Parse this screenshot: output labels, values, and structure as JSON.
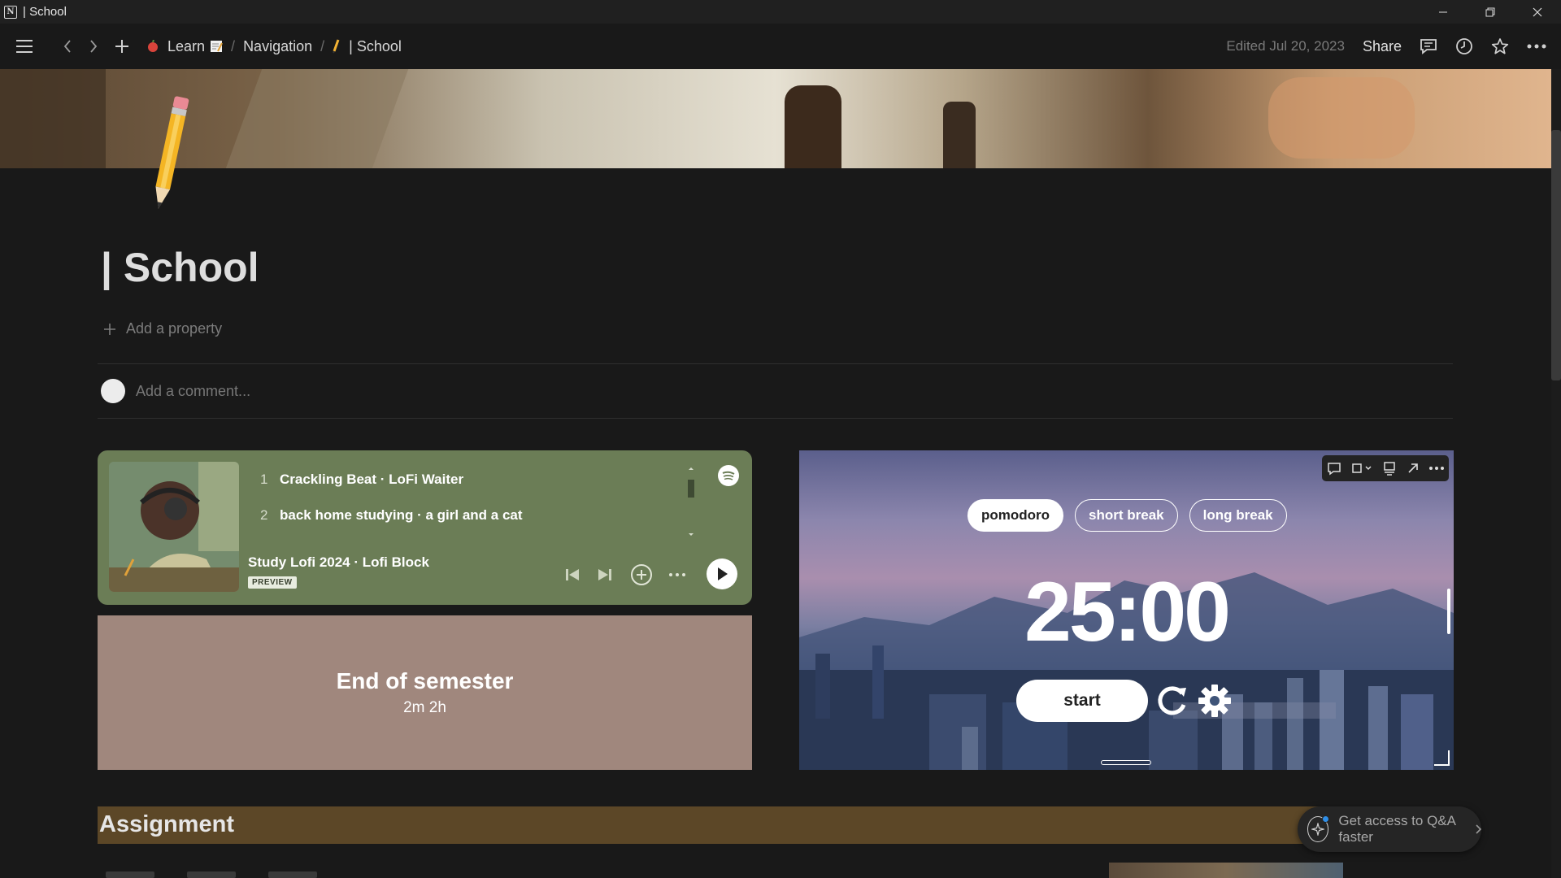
{
  "window": {
    "title": "| School"
  },
  "breadcrumb": {
    "learn": "Learn",
    "navigation": "Navigation",
    "school": "| School",
    "sep": "/"
  },
  "topbar": {
    "edited": "Edited Jul 20, 2023",
    "share": "Share"
  },
  "page": {
    "title": "| School",
    "add_property": "Add a property",
    "comment_placeholder": "Add a comment..."
  },
  "spotify": {
    "tracks": [
      {
        "num": "1",
        "title": "Crackling Beat · LoFi Waiter"
      },
      {
        "num": "2",
        "title": "back home studying · a girl and a cat"
      }
    ],
    "playlist": "Study Lofi 2024 · Lofi Block",
    "badge": "PREVIEW"
  },
  "countdown": {
    "title": "End of semester",
    "value": "2m 2h"
  },
  "pomodoro": {
    "tabs": [
      "pomodoro",
      "short break",
      "long break"
    ],
    "time": "25:00",
    "start": "start"
  },
  "assignment": {
    "title": "Assignment"
  },
  "qa": {
    "text": "Get access to Q&A faster"
  },
  "colors": {
    "spotify_bg": "#6b7d56",
    "countdown_bg": "#a0877d",
    "assignment_bar": "#5c4727"
  }
}
